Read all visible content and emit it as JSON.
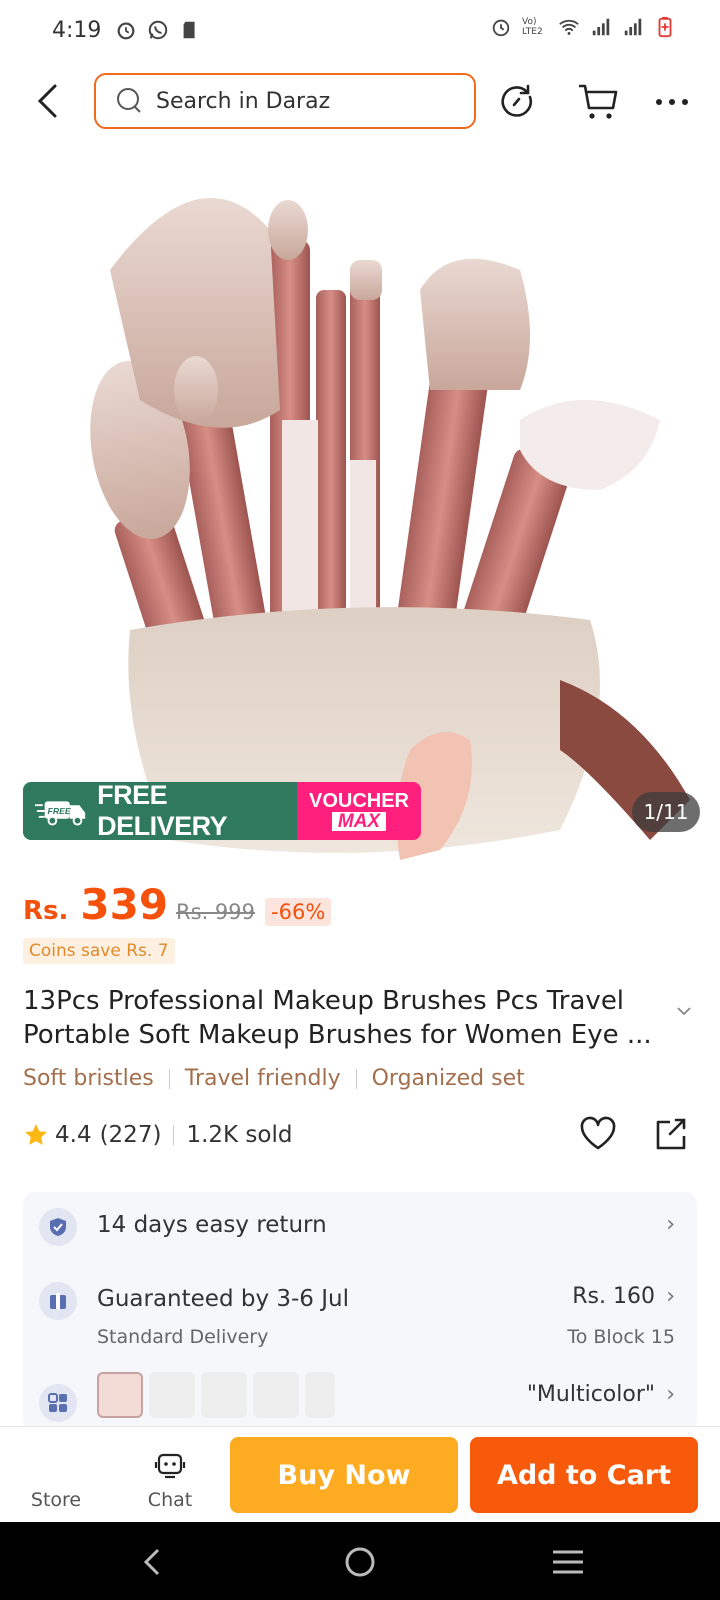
{
  "status_bar": {
    "time": "4:19",
    "left_icons": [
      "alarm-icon",
      "whatsapp-icon",
      "sd-card-icon"
    ],
    "right_icons": [
      "alarm-icon",
      "volte-icon",
      "wifi-icon",
      "signal-icon",
      "signal-icon",
      "battery-icon"
    ],
    "volte_label": "Vo) LTE2"
  },
  "top_bar": {
    "search_placeholder": "Search in Daraz",
    "icons": [
      "back-icon",
      "search-icon",
      "history-icon",
      "cart-icon",
      "more-icon"
    ]
  },
  "hero": {
    "free_delivery_tag": "FREE",
    "free_delivery": "FREE DELIVERY",
    "voucher_line1": "VOUCHER",
    "voucher_line2": "MAX",
    "image_counter": "1/11"
  },
  "product": {
    "price_currency": "Rs.",
    "price": "339",
    "original_price": "Rs. 999",
    "discount": "-66%",
    "coins": "Coins save Rs. 7",
    "title": "13Pcs Professional Makeup Brushes Pcs Travel Portable Soft Makeup Brushes for Women Eye ...",
    "tags": [
      "Soft bristles",
      "Travel friendly",
      "Organized set"
    ],
    "rating": "4.4",
    "reviews": "(227)",
    "sold": "1.2K sold"
  },
  "info": {
    "return_text": "14 days easy return",
    "delivery_text": "Guaranteed by 3-6 Jul",
    "delivery_sub": "Standard Delivery",
    "delivery_price": "Rs. 160",
    "delivery_location": "To Block 15",
    "variant_value": "\"Multicolor\""
  },
  "bottom_bar": {
    "store_label": "Store",
    "chat_label": "Chat",
    "buy_now": "Buy Now",
    "add_to_cart": "Add to Cart"
  },
  "colors": {
    "accent": "#f5510b",
    "buy_now": "#fdab20",
    "add_to_cart": "#f75a0b",
    "free_delivery": "#2f7a5f",
    "voucher": "#ff1f7d",
    "tag_text": "#a36f4c"
  }
}
